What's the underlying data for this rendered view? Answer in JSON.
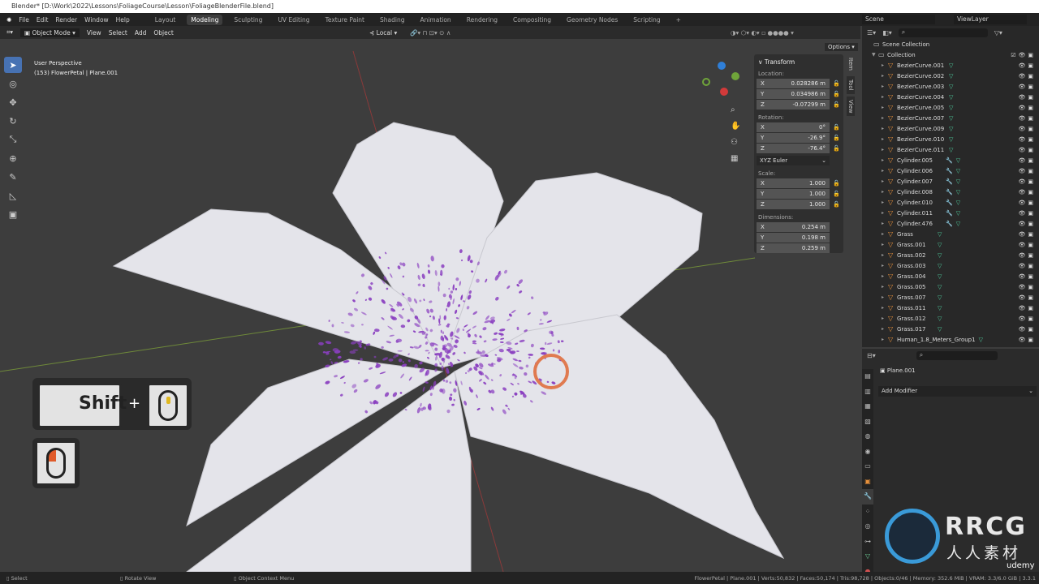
{
  "titlebar": {
    "title": "Blender* [D:\\Work\\2022\\Lessons\\FoliageCourse\\Lesson\\FoliageBlenderFile.blend]"
  },
  "menu": [
    "File",
    "Edit",
    "Render",
    "Window",
    "Help"
  ],
  "workspaces": [
    "Layout",
    "Modeling",
    "Sculpting",
    "UV Editing",
    "Texture Paint",
    "Shading",
    "Animation",
    "Rendering",
    "Compositing",
    "Geometry Nodes",
    "Scripting",
    "+"
  ],
  "active_workspace": "Modeling",
  "header": {
    "mode": "Object Mode",
    "items": [
      "View",
      "Select",
      "Add",
      "Object"
    ],
    "transform_orientation": "Local",
    "options": "Options"
  },
  "scene": {
    "scene": "Scene",
    "view_layer": "ViewLayer"
  },
  "viewport": {
    "perspective": "User Perspective",
    "object_info": "(153) FlowerPetal | Plane.001",
    "key_hint": "Shift",
    "plus": "+"
  },
  "sidebar_tabs": [
    "Item",
    "Tool",
    "View"
  ],
  "transform": {
    "title": "Transform",
    "location_label": "Location:",
    "location": [
      [
        "X",
        "0.028286 m"
      ],
      [
        "Y",
        "0.034986 m"
      ],
      [
        "Z",
        "-0.07299 m"
      ]
    ],
    "rotation_label": "Rotation:",
    "rotation": [
      [
        "X",
        "0°"
      ],
      [
        "Y",
        "-26.9°"
      ],
      [
        "Z",
        "-76.4°"
      ]
    ],
    "rotation_mode": "XYZ Euler",
    "scale_label": "Scale:",
    "scale": [
      [
        "X",
        "1.000"
      ],
      [
        "Y",
        "1.000"
      ],
      [
        "Z",
        "1.000"
      ]
    ],
    "dimensions_label": "Dimensions:",
    "dimensions": [
      [
        "X",
        "0.254 m"
      ],
      [
        "Y",
        "0.198 m"
      ],
      [
        "Z",
        "0.259 m"
      ]
    ]
  },
  "outliner": {
    "scene_collection": "Scene Collection",
    "collection": "Collection",
    "items": [
      "BezierCurve.001",
      "BezierCurve.002",
      "BezierCurve.003",
      "BezierCurve.004",
      "BezierCurve.005",
      "BezierCurve.007",
      "BezierCurve.009",
      "BezierCurve.010",
      "BezierCurve.011",
      "Cylinder.005",
      "Cylinder.006",
      "Cylinder.007",
      "Cylinder.008",
      "Cylinder.010",
      "Cylinder.011",
      "Cylinder.476",
      "Grass",
      "Grass.001",
      "Grass.002",
      "Grass.003",
      "Grass.004",
      "Grass.005",
      "Grass.007",
      "Grass.011",
      "Grass.012",
      "Grass.017",
      "Human_1.8_Meters_Group1"
    ]
  },
  "properties": {
    "object": "Plane.001",
    "add_modifier": "Add Modifier"
  },
  "statusbar": {
    "select": "Select",
    "rotate": "Rotate View",
    "context": "Object Context Menu",
    "stats": "FlowerPetal | Plane.001 | Verts:50,832 | Faces:50,174 | Tris:98,728 | Objects:0/46 | Memory: 352.6 MiB | VRAM: 3.3/6.0 GiB | 3.3.1"
  },
  "watermark": {
    "brand": "RRCG",
    "sub": "人人素材",
    "udemy": "udemy"
  },
  "colors": {
    "accent": "#4772b3",
    "cursor": "#e07a50",
    "petal": "#e4e4ea",
    "speckle": "#8a3fc0"
  }
}
